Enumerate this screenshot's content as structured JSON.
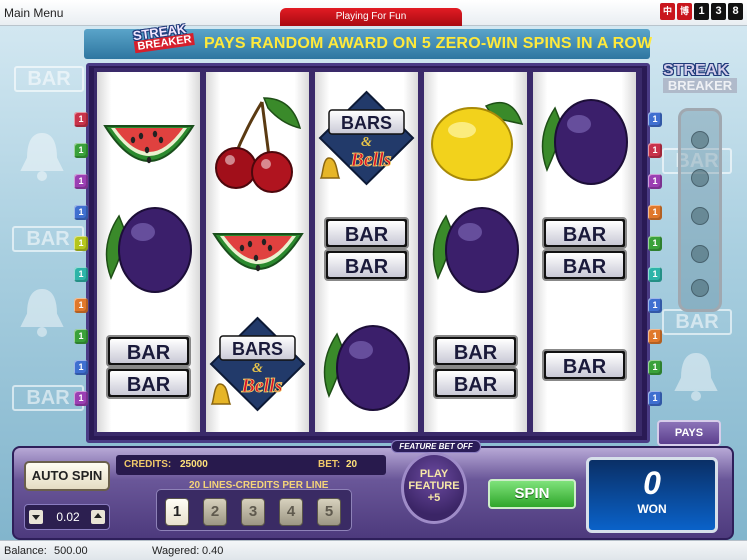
{
  "topbar": {
    "menu_label": "Main Menu",
    "mode_label": "Playing For Fun",
    "icons": [
      "中",
      "博",
      "1",
      "3",
      "8"
    ]
  },
  "promo": {
    "logo_top": "STREAK",
    "logo_bottom": "BREAKER",
    "text": "PAYS RANDOM AWARD ON 5 ZERO-WIN SPINS IN A ROW"
  },
  "side_logo": {
    "top": "STREAK",
    "bottom": "BREAKER"
  },
  "background": {
    "bar_label": "BAR"
  },
  "reels": [
    [
      "watermelon",
      "plum",
      "double-bar"
    ],
    [
      "cherries",
      "watermelon",
      "bars-and-bells"
    ],
    [
      "bars-and-bells",
      "double-bar",
      "plum"
    ],
    [
      "lemon",
      "plum",
      "double-bar"
    ],
    [
      "plum",
      "double-bar",
      "single-bar"
    ]
  ],
  "symbols": {
    "bar_text": "BAR",
    "bars_text": "BARS",
    "amp_text": "&",
    "bells_text": "Bells"
  },
  "line_markers": {
    "left": [
      "1",
      "1",
      "1",
      "1",
      "1",
      "1",
      "1",
      "1",
      "1",
      "1"
    ],
    "right": [
      "1",
      "1",
      "1",
      "1",
      "1",
      "1",
      "1",
      "1",
      "1",
      "1"
    ],
    "colors_left": [
      "#c8324a",
      "#3aa13a",
      "#9b3fb3",
      "#3f6fd0",
      "#b5c61d",
      "#2db4a8",
      "#e0782b",
      "#3aa13a",
      "#3f6fd0",
      "#9b3fb3"
    ],
    "colors_right": [
      "#3f6fd0",
      "#c8324a",
      "#9b3fb3",
      "#e0782b",
      "#3aa13a",
      "#2db4a8",
      "#3f6fd0",
      "#e0782b",
      "#3aa13a",
      "#3f6fd0"
    ]
  },
  "pays_label": "PAYS",
  "panel": {
    "feature_bet_off": "FEATURE BET OFF",
    "autospin_label": "AUTO SPIN",
    "coin_value": "0.02",
    "credits_label": "CREDITS:",
    "credits_value": "25000",
    "bet_label": "BET:",
    "bet_value": "20",
    "lines_label": "20 LINES-CREDITS PER LINE",
    "line_bets": [
      "1",
      "2",
      "3",
      "4",
      "5"
    ],
    "active_line_bet": "1",
    "play_feature": [
      "PLAY",
      "FEATURE",
      "+5"
    ],
    "spin_label": "SPIN",
    "won_value": "0",
    "won_label": "WON"
  },
  "status": {
    "balance_label": "Balance:",
    "balance_value": "500.00",
    "wagered_label": "Wagered:",
    "wagered_value": "0.40"
  }
}
